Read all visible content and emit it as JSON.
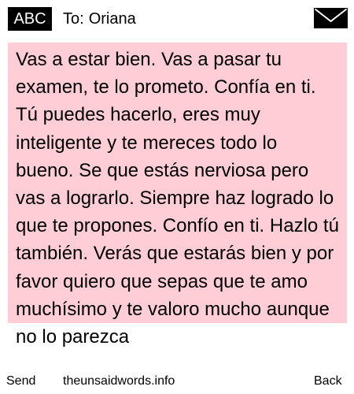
{
  "header": {
    "mode_label": "ABC",
    "to_label": "To:",
    "recipient": "Oriana",
    "envelope_icon": "envelope-icon"
  },
  "message": {
    "body": "Vas a estar bien. Vas a pasar tu examen, te lo prometo. Confía en ti. Tú puedes hacerlo, eres muy inteligente y te mereces todo lo bueno. Se que estás nerviosa pero vas a lograrlo. Siempre haz logrado lo que te propones. Confío en ti. Hazlo tú también. Verás que estarás bien y por favor quiero que sepas que te amo muchísimo y te valoro mucho aunque no lo parezca",
    "highlight_color": "#ffcdd6"
  },
  "footer": {
    "send_label": "Send",
    "site_label": "theunsaidwords.info",
    "back_label": "Back"
  }
}
